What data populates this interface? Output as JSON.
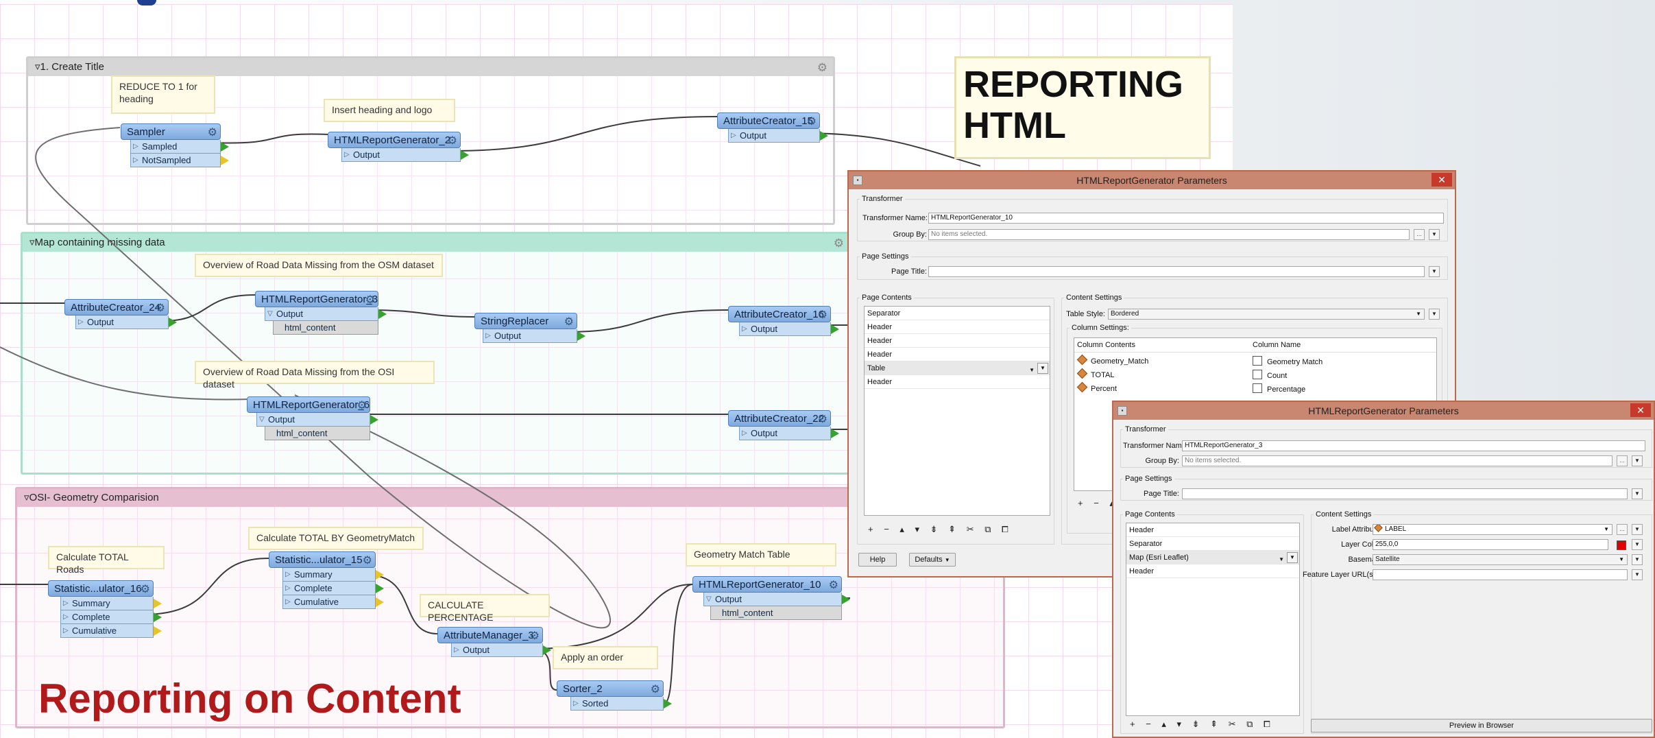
{
  "slide": {
    "big_annotation_line1": "REPORTING",
    "big_annotation_line2": "HTML",
    "title": "Reporting on Content"
  },
  "bookmarks": {
    "create_title": "1. Create Title",
    "map_missing": "Map containing missing data",
    "osi_geometry": "OSI- Geometry Comparision"
  },
  "annotations": {
    "reduce": "REDUCE TO 1 for heading",
    "insert_heading": "Insert heading and logo",
    "osm_overview": "Overview of Road Data Missing from the OSM dataset",
    "osi_overview": "Overview of Road Data Missing from the OSI dataset",
    "calc_total_roads": "Calculate TOTAL Roads",
    "calc_total_geom": "Calculate TOTAL BY GeometryMatch",
    "calc_percentage": "CALCULATE PERCENTAGE",
    "geom_table": "Geometry Match Table",
    "apply_order": "Apply an order"
  },
  "nodes": {
    "sampler": "Sampler",
    "sampled": "Sampled",
    "not_sampled": "NotSampled",
    "html_gen_2": "HTMLReportGenerator_2",
    "attr_creator_15": "AttributeCreator_15",
    "attr_creator_24": "AttributeCreator_24",
    "html_gen_3": "HTMLReportGenerator_3",
    "string_replacer": "StringReplacer",
    "attr_creator_16": "AttributeCreator_16",
    "html_gen_6": "HTMLReportGenerator_6",
    "attr_creator_22": "AttributeCreator_22",
    "stat_16": "Statistic...ulator_16",
    "stat_15": "Statistic...ulator_15",
    "attr_manager_3": "AttributeManager_3",
    "html_gen_10": "HTMLReportGenerator_10",
    "sorter_2": "Sorter_2",
    "output": "Output",
    "html_content": "html_content",
    "summary": "Summary",
    "complete": "Complete",
    "cumulative": "Cumulative",
    "sorted": "Sorted"
  },
  "dialog1": {
    "title": "HTMLReportGenerator Parameters",
    "transformer_group": "Transformer",
    "transformer_name_label": "Transformer Name:",
    "transformer_name": "HTMLReportGenerator_10",
    "group_by_label": "Group By:",
    "group_by": "No items selected.",
    "page_settings": "Page Settings",
    "page_title_label": "Page Title:",
    "page_title": "",
    "page_contents": "Page Contents",
    "contents": [
      "Separator",
      "Header",
      "Header",
      "Header",
      "Table",
      "Header"
    ],
    "content_settings": "Content Settings",
    "table_style_label": "Table Style:",
    "table_style": "Bordered",
    "column_settings": "Column Settings:",
    "col_contents_header": "Column Contents",
    "col_name_header": "Column Name",
    "columns": [
      {
        "content": "Geometry_Match",
        "name": "Geometry Match"
      },
      {
        "content": "TOTAL",
        "name": "Count"
      },
      {
        "content": "Percent",
        "name": "Percentage"
      }
    ],
    "help": "Help",
    "defaults": "Defaults"
  },
  "dialog2": {
    "title": "HTMLReportGenerator Parameters",
    "transformer_group": "Transformer",
    "transformer_name_label": "Transformer Name:",
    "transformer_name": "HTMLReportGenerator_3",
    "group_by_label": "Group By:",
    "group_by": "No items selected.",
    "page_settings": "Page Settings",
    "page_title_label": "Page Title:",
    "page_title": "",
    "page_contents": "Page Contents",
    "contents": [
      "Header",
      "Separator",
      "Map (Esri Leaflet)",
      "Header"
    ],
    "content_settings": "Content Settings",
    "label_attribute_label": "Label Attribute:",
    "label_attribute": "LABEL",
    "layer_color_label": "Layer Color:",
    "layer_color": "255,0,0",
    "basemap_label": "Basemap:",
    "basemap": "Satellite",
    "feature_layer_label": "Feature Layer URL(s):",
    "feature_layer": "",
    "preview": "Preview in Browser"
  },
  "colors": {
    "node_blue": "#8fb8e8",
    "link_green": "#39a132",
    "slide_title_red": "#b01a1a",
    "dialog_frame": "#c98670"
  }
}
